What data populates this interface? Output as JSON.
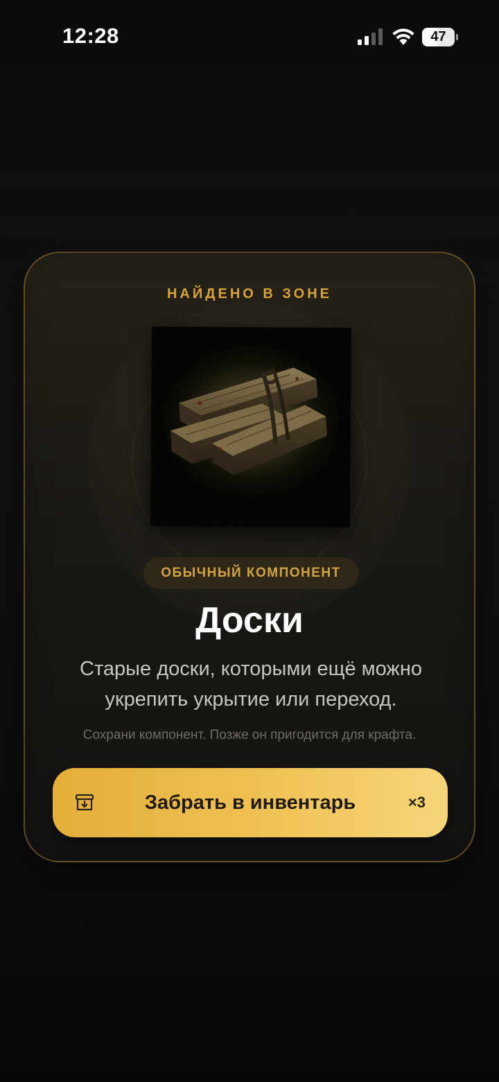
{
  "status_bar": {
    "time": "12:28",
    "battery_level": "47",
    "battery_fraction": 0.47,
    "signal_bars_active": 2
  },
  "card": {
    "found_label": "НАЙДЕНО В ЗОНЕ",
    "rarity": "ОБЫЧНЫЙ КОМПОНЕНТ",
    "title": "Доски",
    "description": "Старые доски, которыми ещё можно укрепить укрытие или переход.",
    "hint": "Сохрани компонент. Позже он пригодится для крафта.",
    "image_icon": "wooden-planks-icon",
    "action": {
      "label": "Забрать в инвентарь",
      "count": "×3",
      "icon": "archive-icon"
    }
  },
  "colors": {
    "accent_gold": "#d8a33a",
    "button_gold": "#efc255",
    "card_bg": "#1a1814"
  }
}
